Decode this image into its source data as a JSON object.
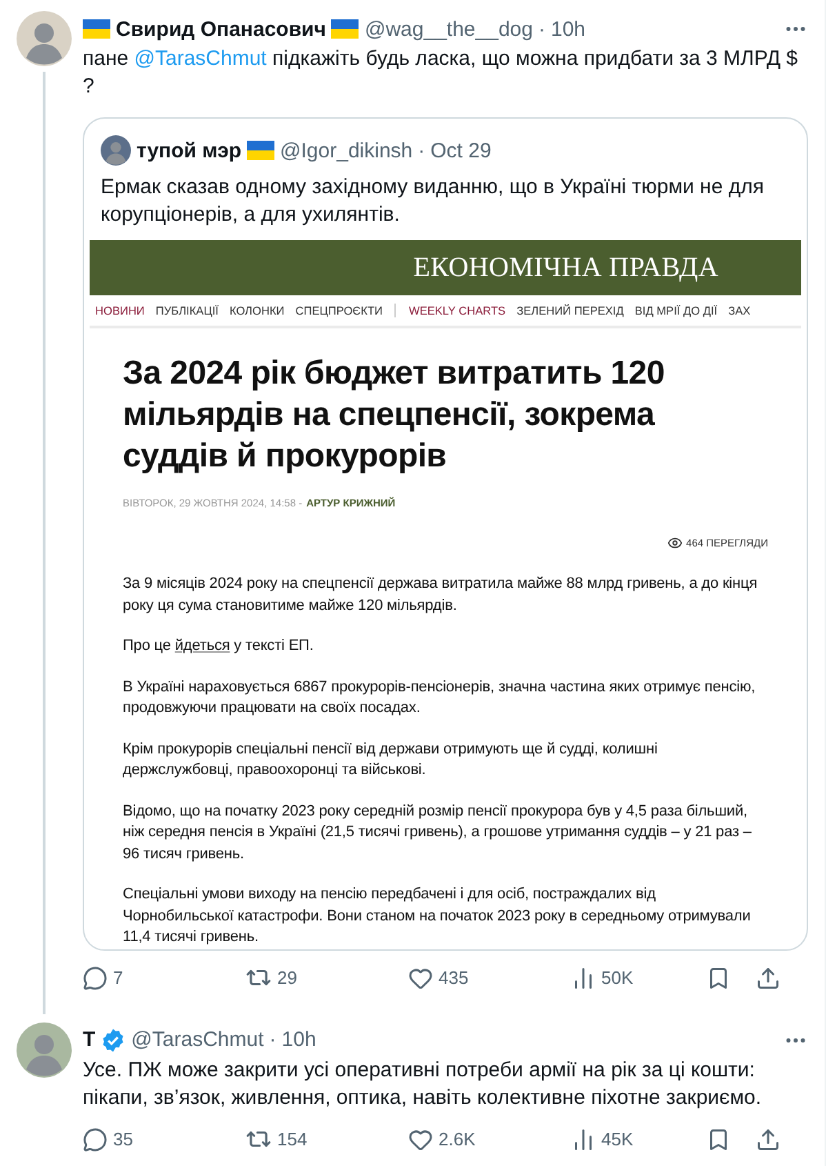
{
  "tweets": [
    {
      "author": {
        "name": "Свирид Опанасович",
        "flag_left": true,
        "flag_right": true,
        "verified": false,
        "handle": "@wag__the__dog",
        "separator": "·",
        "time": "10h"
      },
      "text": [
        {
          "kind": "text",
          "text": "пане "
        },
        {
          "kind": "mention",
          "text": "@TarasChmut"
        },
        {
          "kind": "text",
          "text": " підкажіть будь ласка, що можна придбати за 3 МЛРД $ ?"
        }
      ],
      "quote": {
        "author": {
          "name": "тупой мэр",
          "flag_right": true,
          "handle": "@Igor_dikinsh",
          "separator": "·",
          "time": "Oct 29"
        },
        "text": "Ермак сказав одному західному виданню, що в Україні тюрми не для корупціонерів, а для ухилянтів.",
        "article": {
          "masthead": "ЕКОНОМІЧНА ПРАВДА",
          "nav": [
            {
              "label": "НОВИНИ",
              "accent": true,
              "divider_before": false
            },
            {
              "label": "ПУБЛІКАЦІЇ",
              "accent": false,
              "divider_before": false
            },
            {
              "label": "КОЛОНКИ",
              "accent": false,
              "divider_before": false
            },
            {
              "label": "СПЕЦПРОЄКТИ",
              "accent": false,
              "divider_before": false
            },
            {
              "label": "WEEKLY CHARTS",
              "accent": true,
              "divider_before": true
            },
            {
              "label": "ЗЕЛЕНИЙ ПЕРЕХІД",
              "accent": false,
              "divider_before": false
            },
            {
              "label": "ВІД МРІЇ ДО ДІЇ",
              "accent": false,
              "divider_before": false
            },
            {
              "label": "ЗАХ",
              "accent": false,
              "divider_before": false
            }
          ],
          "headline": "За 2024 рік бюджет витратить 120 мільярдів на спецпенсії, зокрема суддів й прокурорів",
          "date": "ВІВТОРОК, 29 ЖОВТНЯ 2024, 14:58 -",
          "byline": "АРТУР КРИЖНИЙ",
          "views": "464 ПЕРЕГЛЯДИ",
          "paragraphs": [
            [
              {
                "kind": "text",
                "text": "За 9 місяців 2024 року на спецпенсії держава витратила майже 88 млрд гривень, а до кінця року ця сума становитиме майже 120 мільярдів."
              }
            ],
            [
              {
                "kind": "text",
                "text": "Про це "
              },
              {
                "kind": "link",
                "text": "йдеться"
              },
              {
                "kind": "text",
                "text": " у тексті ЕП."
              }
            ],
            [
              {
                "kind": "text",
                "text": "В Україні нараховується 6867 прокурорів-пенсіонерів, значна частина яких отримує пенсію, продовжуючи працювати на своїх посадах."
              }
            ],
            [
              {
                "kind": "text",
                "text": "Крім прокурорів спеціальні пенсії від держави отримують ще й судді, колишні держслужбовці, правоохоронці та військові."
              }
            ],
            [
              {
                "kind": "text",
                "text": "Відомо, що на початку 2023 року середній розмір пенсії прокурора був у 4,5 раза більший, ніж середня пенсія в Україні (21,5 тисячі гривень), а грошове утримання суддів – у 21 раз – 96 тисяч гривень."
              }
            ],
            [
              {
                "kind": "text",
                "text": "Спеціальні умови виходу на пенсію передбачені і для осіб, постраждалих від Чорнобильської катастрофи. Вони станом на початок 2023 року в середньому отримували 11,4 тисячі гривень."
              }
            ]
          ]
        }
      },
      "stats": {
        "replies": "7",
        "reposts": "29",
        "likes": "435",
        "views": "50K"
      },
      "thread_line": true
    },
    {
      "author": {
        "name": "T",
        "flag_left": false,
        "flag_right": false,
        "verified": true,
        "handle": "@TarasChmut",
        "separator": "·",
        "time": "10h"
      },
      "text": [
        {
          "kind": "text",
          "text": "Усе. ПЖ може закрити усі оперативні потреби армії на рік за ці кошти: пікапи, зв’язок, живлення, оптика, навіть колективне піхотне закриємо."
        }
      ],
      "stats": {
        "replies": "35",
        "reposts": "154",
        "likes": "2.6K",
        "views": "45K"
      },
      "thread_line": false
    }
  ]
}
